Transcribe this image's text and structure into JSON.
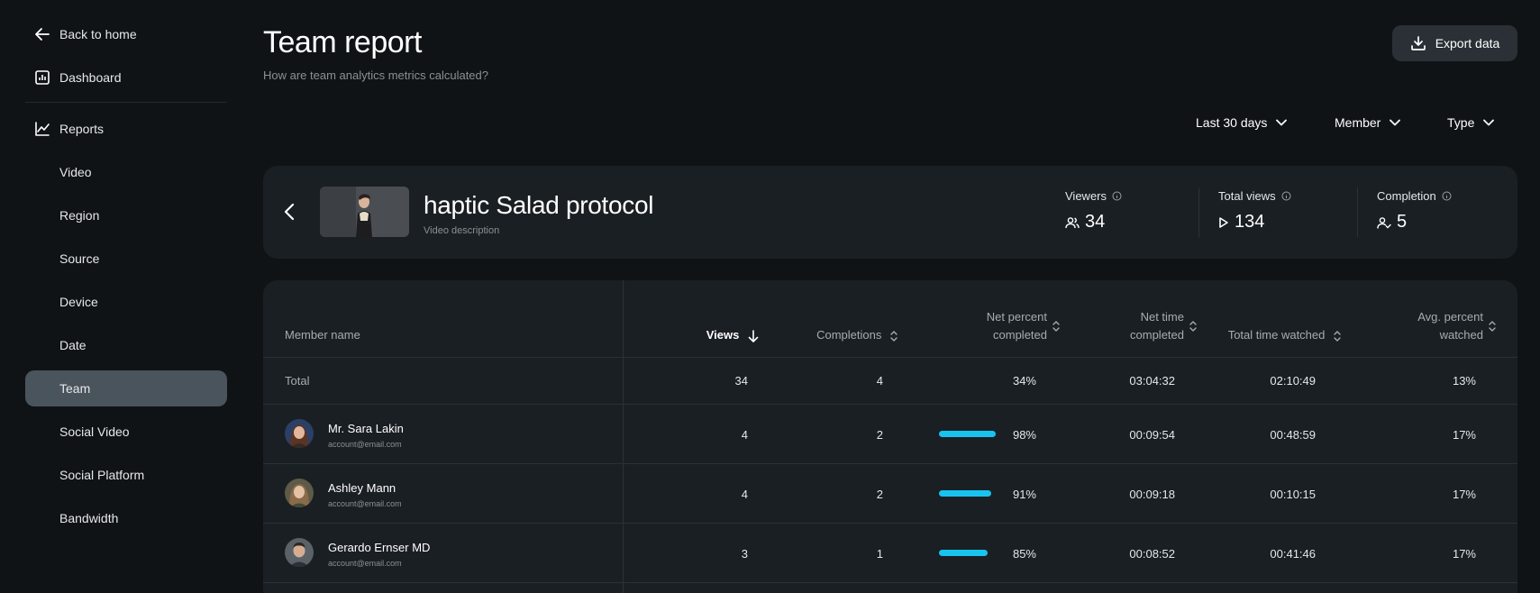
{
  "sidebar": {
    "items": [
      {
        "label": "Back to home",
        "icon": "arrow-left-icon"
      },
      {
        "label": "Dashboard",
        "icon": "dashboard-icon"
      },
      {
        "label": "Reports",
        "icon": "chart-line-icon"
      },
      {
        "label": "Video"
      },
      {
        "label": "Region"
      },
      {
        "label": "Source"
      },
      {
        "label": "Device"
      },
      {
        "label": "Date"
      },
      {
        "label": "Team",
        "active": true
      },
      {
        "label": "Social Video"
      },
      {
        "label": "Social Platform"
      },
      {
        "label": "Bandwidth"
      }
    ]
  },
  "header": {
    "title": "Team report",
    "subtitle": "How are team analytics metrics calculated?",
    "export_label": "Export data"
  },
  "filters": [
    {
      "label": "Last 30 days"
    },
    {
      "label": "Member"
    },
    {
      "label": "Type"
    }
  ],
  "video": {
    "title": "haptic Salad protocol",
    "description": "Video description",
    "stats": [
      {
        "label": "Viewers",
        "value": "34",
        "icon": "users-icon"
      },
      {
        "label": "Total views",
        "value": "134",
        "icon": "play-icon"
      },
      {
        "label": "Completion",
        "value": "5",
        "icon": "user-check-icon"
      }
    ]
  },
  "table": {
    "headers": {
      "member": "Member name",
      "views": "Views",
      "completions": "Completions",
      "net_percent_1": "Net percent",
      "net_percent_2": "completed",
      "net_time_1": "Net time",
      "net_time_2": "completed",
      "total_time": "Total time watched",
      "avg_percent_1": "Avg. percent",
      "avg_percent_2": "watched"
    },
    "total": {
      "label": "Total",
      "views": "34",
      "completions": "4",
      "net_percent": "34%",
      "net_time": "03:04:32",
      "total_time": "02:10:49",
      "avg_percent": "13%"
    },
    "rows": [
      {
        "name": "Mr. Sara Lakin",
        "email": "account@email.com",
        "views": "4",
        "completions": "2",
        "net_percent": "98%",
        "net_percent_value": 0.98,
        "net_time": "00:09:54",
        "total_time": "00:48:59",
        "avg_percent": "17%"
      },
      {
        "name": "Ashley Mann",
        "email": "account@email.com",
        "views": "4",
        "completions": "2",
        "net_percent": "91%",
        "net_percent_value": 0.91,
        "net_time": "00:09:18",
        "total_time": "00:10:15",
        "avg_percent": "17%"
      },
      {
        "name": "Gerardo Ernser MD",
        "email": "account@email.com",
        "views": "3",
        "completions": "1",
        "net_percent": "85%",
        "net_percent_value": 0.85,
        "net_time": "00:08:52",
        "total_time": "00:41:46",
        "avg_percent": "17%"
      }
    ]
  },
  "colors": {
    "accent": "#18c3f0",
    "active_nav": "#4a545d",
    "background": "#101316",
    "card": "#1a1f24"
  }
}
